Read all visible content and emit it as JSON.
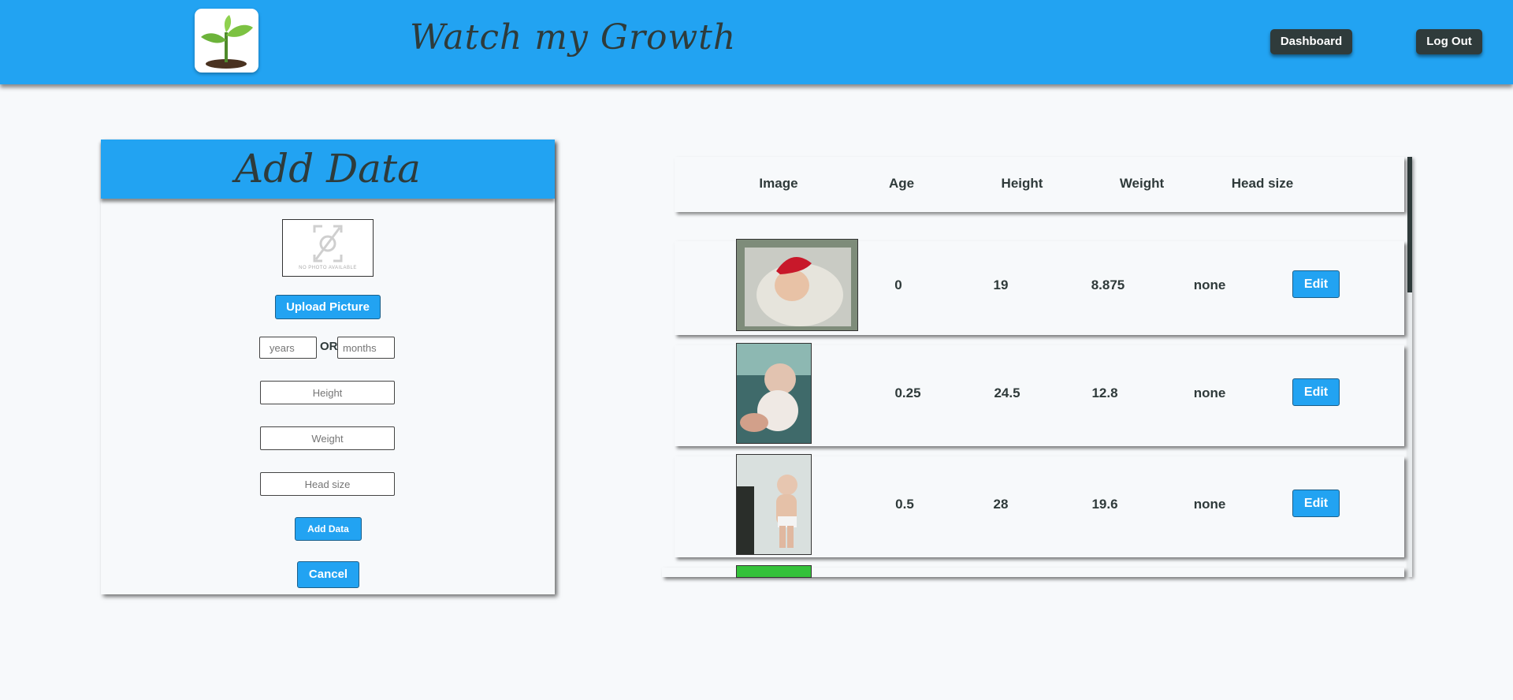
{
  "header": {
    "app_title": "Watch my Growth",
    "nav": {
      "dashboard_label": "Dashboard",
      "logout_label": "Log Out"
    },
    "colors": {
      "bar": "#22a3f2",
      "button": "#2f3b3b"
    }
  },
  "panel": {
    "title": "Add Data",
    "no_photo_text": "NO PHOTO AVAILABLE",
    "upload_label": "Upload Picture",
    "years_placeholder": "years",
    "or_label": "OR",
    "months_placeholder": "months",
    "height_placeholder": "Height",
    "weight_placeholder": "Weight",
    "head_placeholder": "Head size",
    "add_label": "Add Data",
    "cancel_label": "Cancel"
  },
  "table": {
    "columns": [
      "Image",
      "Age",
      "Height",
      "Weight",
      "Head size"
    ],
    "rows": [
      {
        "age": "0",
        "height": "19",
        "weight": "8.875",
        "head": "none",
        "edit": "Edit"
      },
      {
        "age": "0.25",
        "height": "24.5",
        "weight": "12.8",
        "head": "none",
        "edit": "Edit"
      },
      {
        "age": "0.5",
        "height": "28",
        "weight": "19.6",
        "head": "none",
        "edit": "Edit"
      }
    ]
  }
}
